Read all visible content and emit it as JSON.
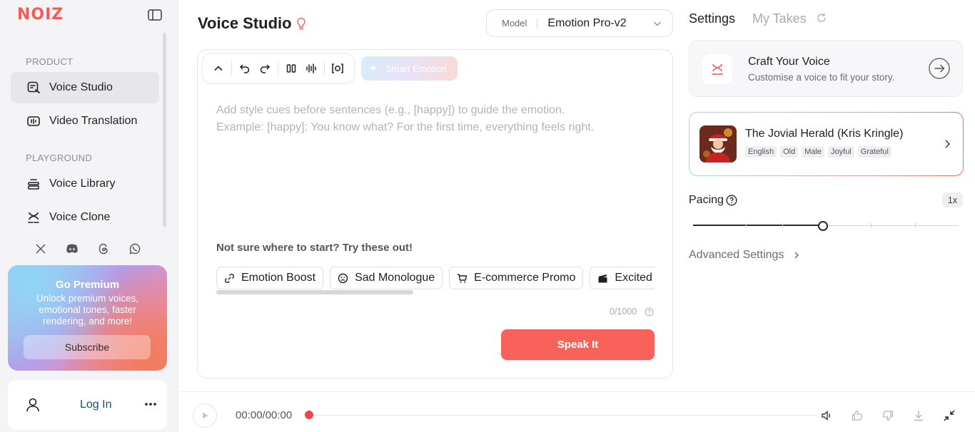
{
  "app": {
    "logo": "NOIZ"
  },
  "sidebar": {
    "product_label": "PRODUCT",
    "product_items": [
      {
        "label": "Voice Studio",
        "icon": "voice-studio-icon",
        "active": true
      },
      {
        "label": "Video Translation",
        "icon": "video-translation-icon"
      }
    ],
    "playground_label": "PLAYGROUND",
    "playground_items": [
      {
        "label": "Voice Library",
        "icon": "voice-library-icon"
      },
      {
        "label": "Voice Clone",
        "icon": "voice-clone-icon"
      }
    ],
    "socials": [
      "x-icon",
      "discord-icon",
      "threads-icon",
      "whatsapp-icon"
    ],
    "premium": {
      "title": "Go Premium",
      "description": "Unlock premium voices, emotional tones, faster rendering, and more!",
      "button": "Subscribe"
    },
    "login": {
      "label": "Log In"
    }
  },
  "main": {
    "title": "Voice Studio",
    "model": {
      "label": "Model",
      "value": "Emotion Pro-v2"
    },
    "editor": {
      "smart_emotion": "Smart Emotion",
      "placeholder_line1": "Add style cues before sentences (e.g., [happy]) to guide the emotion.",
      "placeholder_line2": "Example: [happy]: You know what? For the first time, everything feels right.",
      "suggest_title": "Not sure where to start? Try these out!",
      "chips": [
        {
          "label": "Emotion Boost",
          "icon": "link-icon"
        },
        {
          "label": "Sad Monologue",
          "icon": "sad-face-icon"
        },
        {
          "label": "E-commerce Promo",
          "icon": "cart-icon"
        },
        {
          "label": "Excited L",
          "icon": "clapper-icon"
        }
      ],
      "counter": "0/1000",
      "speak_button": "Speak It"
    }
  },
  "right": {
    "tabs": {
      "settings": "Settings",
      "takes": "My Takes"
    },
    "craft": {
      "title": "Craft Your Voice",
      "subtitle": "Customise a voice to fit your story."
    },
    "voice": {
      "name": "The Jovial Herald (Kris Kringle)",
      "tags": [
        "English",
        "Old",
        "Male",
        "Joyful",
        "Grateful"
      ]
    },
    "pacing": {
      "label": "Pacing",
      "value": "1x",
      "level": 0.49
    },
    "advanced": "Advanced Settings"
  },
  "player": {
    "time": "00:00/00:00",
    "progress": 0
  },
  "colors": {
    "accent": "#f9625a",
    "logo": "#fa5a4f",
    "link": "#1c4d7e"
  }
}
